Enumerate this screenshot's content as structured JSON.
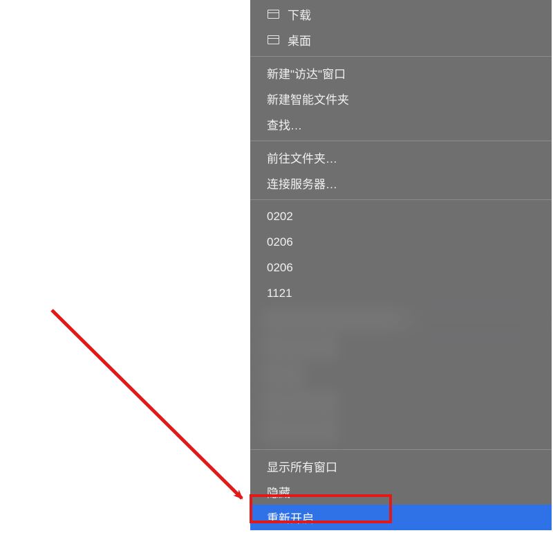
{
  "menu": {
    "group_locations": [
      {
        "icon": "window",
        "label": "下载"
      },
      {
        "icon": "window",
        "label": "桌面"
      }
    ],
    "group_new": [
      {
        "label": "新建\"访达\"窗口"
      },
      {
        "label": "新建智能文件夹"
      },
      {
        "label": "查找…"
      }
    ],
    "group_goto": [
      {
        "label": "前往文件夹…"
      },
      {
        "label": "连接服务器…"
      }
    ],
    "group_recent": [
      {
        "label": "0202"
      },
      {
        "label": "0206"
      },
      {
        "label": "0206"
      },
      {
        "label": "1121"
      }
    ],
    "group_window": [
      {
        "label": "显示所有窗口"
      },
      {
        "label": "隐藏"
      },
      {
        "label": "重新开启",
        "highlight": true
      }
    ]
  },
  "annotation": {
    "color": "#e11919"
  }
}
